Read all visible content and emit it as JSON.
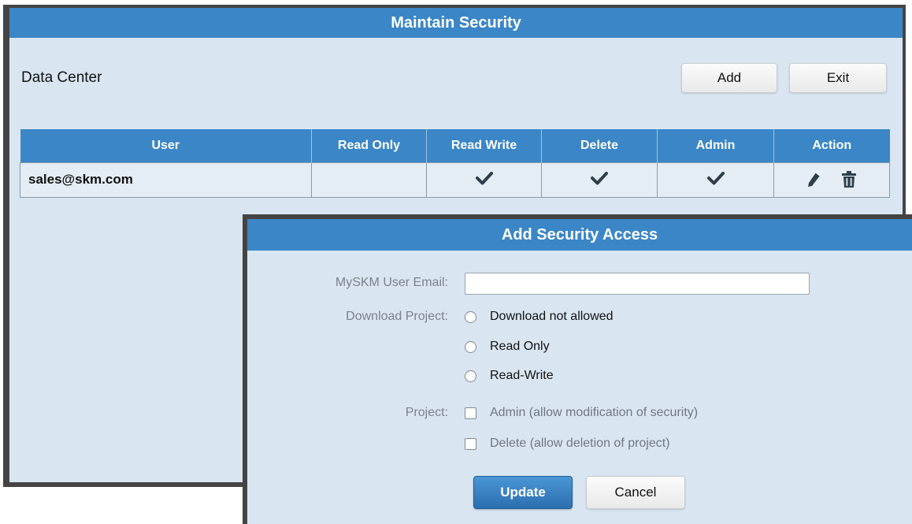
{
  "main_window": {
    "title": "Maintain Security",
    "context_label": "Data Center",
    "add_label": "Add",
    "exit_label": "Exit"
  },
  "table": {
    "columns": [
      "User",
      "Read Only",
      "Read Write",
      "Delete",
      "Admin",
      "Action"
    ],
    "rows": [
      {
        "user": "sales@skm.com",
        "read_only": false,
        "read_write": true,
        "delete": true,
        "admin": true,
        "actions": [
          "edit-icon",
          "trash-icon"
        ]
      }
    ]
  },
  "dialog": {
    "title": "Add Security Access",
    "email_label": "MySKM User Email:",
    "email_value": "",
    "download_label": "Download Project:",
    "download_options": [
      "Download not allowed",
      "Read Only",
      "Read-Write"
    ],
    "project_label": "Project:",
    "project_options": [
      "Admin (allow modification of security)",
      "Delete (allow deletion of project)"
    ],
    "update_label": "Update",
    "cancel_label": "Cancel"
  },
  "colors": {
    "titlebar": "#3b86c6",
    "panel": "#d9e6f2",
    "checkmark": "#2f3e4b"
  }
}
